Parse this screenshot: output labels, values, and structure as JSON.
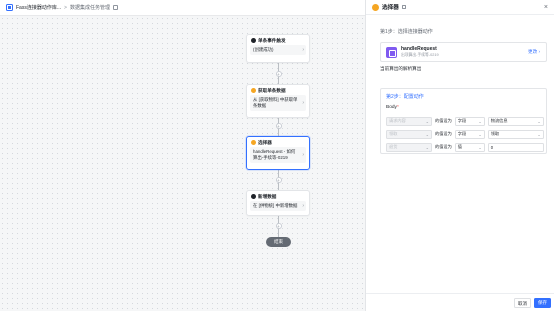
{
  "topbar": {
    "app_name": "Fass连接器动作库...",
    "separator": ">",
    "breadcrumb": "数据集成任务管理"
  },
  "flow": {
    "nodes": [
      {
        "title": "单条事件触发",
        "body": "(创建成功)",
        "icon_color": "#1f2329"
      },
      {
        "title": "获取单条数据",
        "body": "从 [获取物料] 中获取单条数据",
        "icon_color": "#f5a623"
      },
      {
        "title": "选择器",
        "body": "handleRequest - 如何 算出-手续等-0219",
        "icon_color": "#f5a623"
      },
      {
        "title": "新增数据",
        "body": "在 [供物统] 中新增数据",
        "icon_color": "#1f2329"
      }
    ],
    "end_label": "结束"
  },
  "panel": {
    "title": "选择器",
    "step1_label": "第1步：选择连接器动作",
    "action": {
      "name": "handleRequest",
      "subtitle": "出项算出-手续等-0219",
      "change_label": "更改"
    },
    "hint": "当前算出的解析算出",
    "step2_label": "第2步：配置动作",
    "body_label": "Body",
    "required_mark": "*",
    "rows": [
      {
        "field": "请求内容",
        "set_label": "的值设为",
        "type": "字段",
        "value": "物流信息"
      },
      {
        "field": "领取",
        "set_label": "的值设为",
        "type": "字段",
        "value": "领取"
      },
      {
        "field": "退货",
        "set_label": "的值设为",
        "type": "值",
        "value": "0"
      }
    ],
    "cancel_label": "取消",
    "save_label": "保存"
  }
}
